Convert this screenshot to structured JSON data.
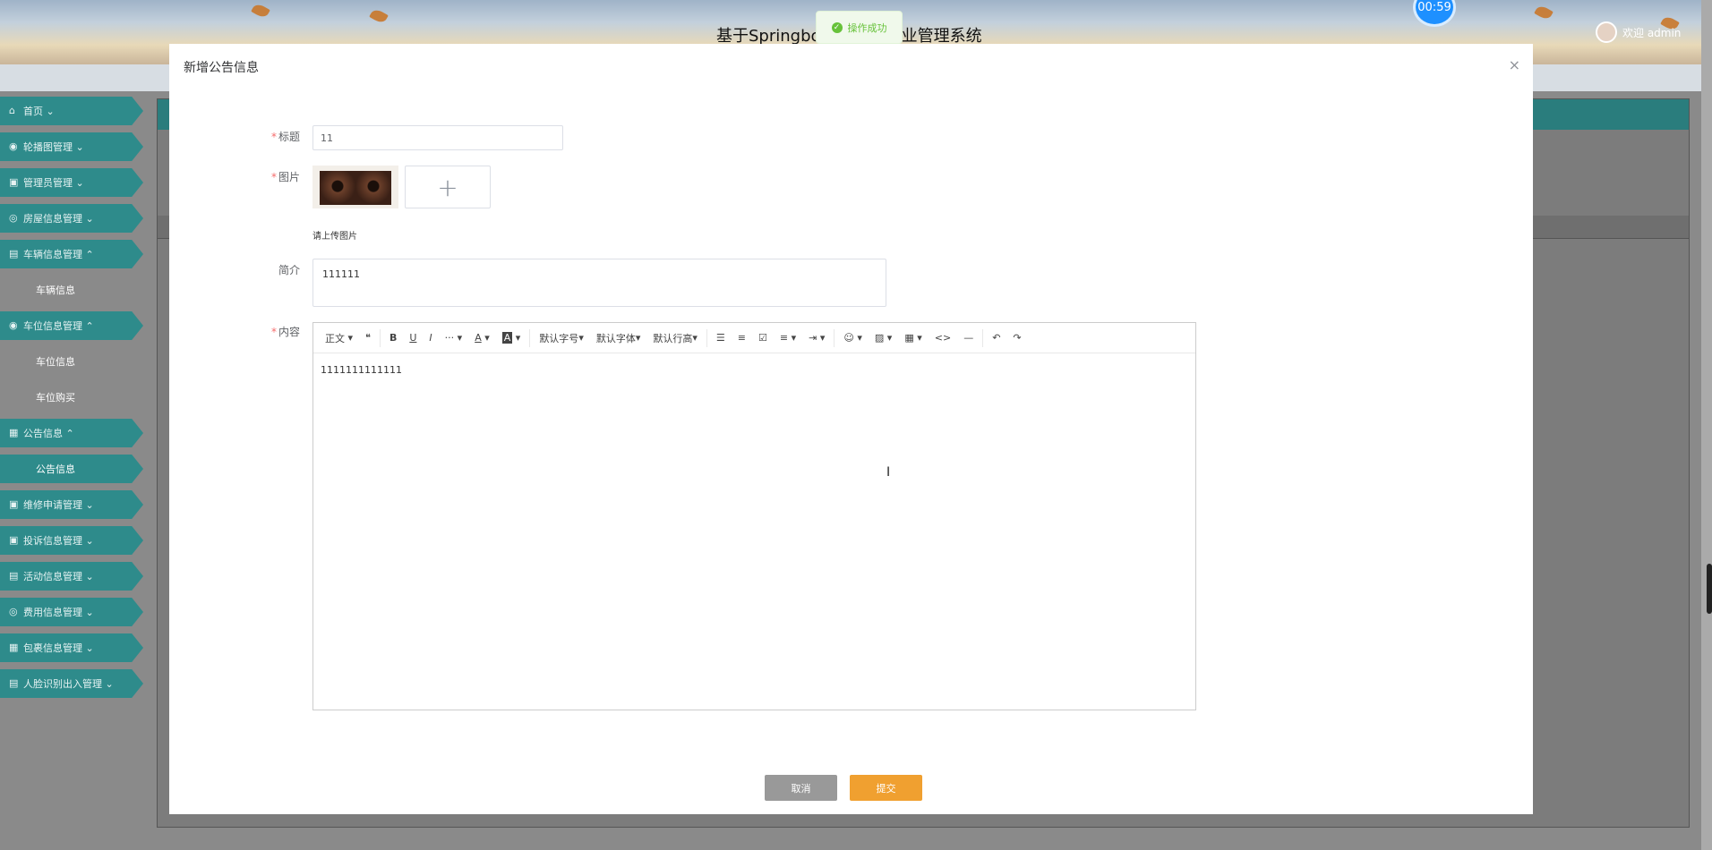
{
  "header": {
    "system_title": "基于Springboot的智慧物业管理系统",
    "timer": "00:59",
    "welcome": "欢迎 admin"
  },
  "toast": {
    "text": "操作成功",
    "color": "#67c23a"
  },
  "sidebar": {
    "items": [
      {
        "icon": "home-icon",
        "label": "首页"
      },
      {
        "icon": "picture-icon",
        "label": "轮播图管理"
      },
      {
        "icon": "user-icon",
        "label": "管理员管理"
      },
      {
        "icon": "house-icon",
        "label": "房屋信息管理"
      },
      {
        "icon": "car-icon",
        "label": "车辆信息管理",
        "sub": [
          "车辆信息"
        ]
      },
      {
        "icon": "parking-icon",
        "label": "车位信息管理",
        "sub": [
          "车位信息",
          "车位购买"
        ]
      },
      {
        "icon": "grid-icon",
        "label": "公告信息",
        "sub": [
          "公告信息"
        ],
        "active_sub": 0
      },
      {
        "icon": "repair-icon",
        "label": "维修申请管理"
      },
      {
        "icon": "complaint-icon",
        "label": "投诉信息管理"
      },
      {
        "icon": "activity-icon",
        "label": "活动信息管理"
      },
      {
        "icon": "fee-icon",
        "label": "费用信息管理"
      },
      {
        "icon": "package-icon",
        "label": "包裹信息管理"
      },
      {
        "icon": "face-icon",
        "label": "人脸识别出入管理"
      }
    ],
    "accent": "#2e8b8b"
  },
  "dialog": {
    "title": "新增公告信息",
    "close": "×",
    "form": {
      "title_label": "标题",
      "title_value": "11",
      "image_label": "图片",
      "upload_plus": "+",
      "upload_hint": "请上传图片",
      "summary_label": "简介",
      "summary_value": "111111",
      "content_label": "内容",
      "content_value": "1111111111111",
      "required_mark": "*"
    },
    "toolbar": {
      "heading": "正文",
      "quote": "❝",
      "bold": "B",
      "underline": "U",
      "italic": "I",
      "more": "···",
      "font_color": "A",
      "bg_color": "A",
      "font_size": "默认字号",
      "font_family": "默认字体",
      "line_height": "默认行高",
      "bullet_list": "☰",
      "number_list": "≡",
      "todo": "☑",
      "align": "≡",
      "indent": "⇥",
      "emoji": "☺",
      "image": "▨",
      "table": "▦",
      "code": "<>",
      "divider": "—",
      "undo": "↶",
      "redo": "↷"
    },
    "buttons": {
      "cancel": "取消",
      "submit": "提交"
    }
  }
}
